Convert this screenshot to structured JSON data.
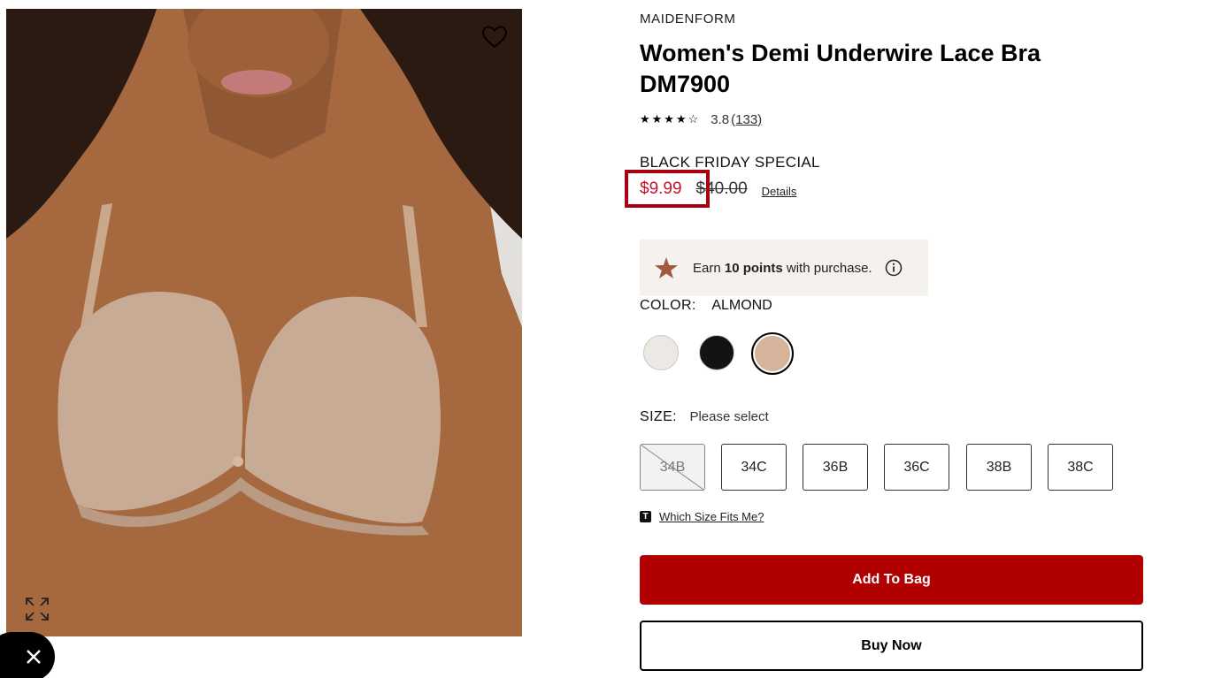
{
  "product": {
    "brand": "MAIDENFORM",
    "title": "Women's Demi Underwire Lace Bra DM7900",
    "rating": {
      "stars_glyphs": "★★★★☆",
      "value": "3.8",
      "review_count": "(133)"
    },
    "promo_label": "BLACK FRIDAY SPECIAL",
    "price": {
      "sale": "$9.99",
      "original": "$40.00",
      "details_link": "Details"
    },
    "points": {
      "prefix": "Earn ",
      "points": "10 points",
      "suffix": " with purchase.",
      "icon": "star-icon",
      "info_icon": "info-icon"
    },
    "color": {
      "label": "COLOR:",
      "selected": "ALMOND",
      "swatches": [
        {
          "name": "ivory-swatch",
          "color": "#ece9e4",
          "selected": false
        },
        {
          "name": "black-swatch",
          "color": "#141212",
          "selected": false
        },
        {
          "name": "almond-swatch",
          "color": "#d6b49c",
          "selected": true
        }
      ]
    },
    "size": {
      "label": "SIZE:",
      "value": "Please select",
      "options": [
        {
          "label": "34B",
          "available": false
        },
        {
          "label": "34C",
          "available": true
        },
        {
          "label": "36B",
          "available": true
        },
        {
          "label": "36C",
          "available": true
        },
        {
          "label": "38B",
          "available": true
        },
        {
          "label": "38C",
          "available": true
        }
      ]
    },
    "fit_link": {
      "badge": "T",
      "text": "Which Size Fits Me?"
    }
  },
  "actions": {
    "add_to_bag": "Add To Bag",
    "buy_now": "Buy Now"
  },
  "image_controls": {
    "wishlist_icon": "heart-icon",
    "zoom_icon": "expand-icon",
    "close_icon": "close-icon"
  },
  "colors": {
    "sale_red": "#c8102e",
    "primary_button": "#b10000",
    "highlight_border": "#a8000e",
    "points_bg": "#f4f1ef"
  }
}
